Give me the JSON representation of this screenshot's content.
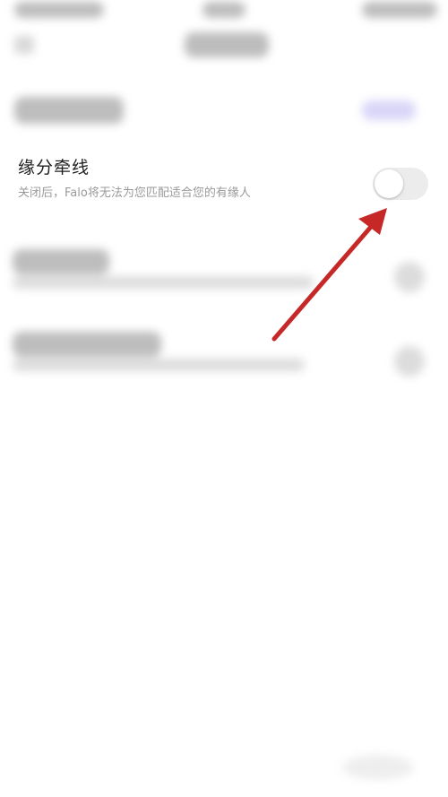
{
  "setting": {
    "title": "缘分牵线",
    "description": "关闭后，Falo将无法为您匹配适合您的有缘人",
    "enabled": false
  },
  "colors": {
    "annotation_arrow": "#c62828",
    "toggle_off_track": "#ececec",
    "description_text": "#9a9a9a"
  },
  "icons": {
    "back": "back-arrow-icon",
    "annotation": "red-arrow-annotation-icon"
  }
}
